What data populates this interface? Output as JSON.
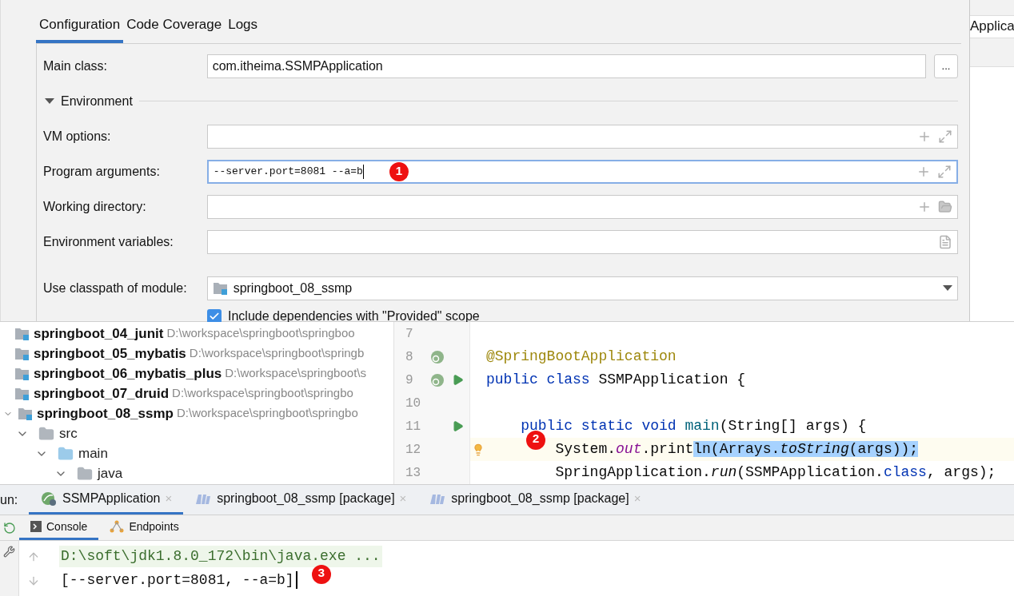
{
  "background_fragment": "Applica",
  "dialog": {
    "tabs": [
      {
        "label": "Configuration",
        "selected": true
      },
      {
        "label": "Code Coverage",
        "selected": false
      },
      {
        "label": "Logs",
        "selected": false
      }
    ],
    "main_class": {
      "label": "Main class:",
      "value": "com.itheima.SSMPApplication",
      "browse": "..."
    },
    "section": {
      "title": "Environment",
      "expanded": true
    },
    "fields": [
      {
        "label": "VM options:",
        "kind": "expandable",
        "focused": false
      },
      {
        "label": "Program arguments:",
        "kind": "expandable",
        "value": "--server.port=8081 --a=b",
        "focused": true,
        "marker": "1"
      },
      {
        "label": "Working directory:",
        "kind": "directory",
        "focused": false
      },
      {
        "label": "Environment variables:",
        "kind": "variables",
        "focused": false
      }
    ],
    "module": {
      "label": "Use classpath of module:",
      "value": "springboot_08_ssmp"
    },
    "include_dependencies": {
      "label": "Include dependencies with \"Provided\" scope",
      "checked": true
    }
  },
  "project_tree": [
    {
      "name": "springboot_04_junit",
      "path": "D:\\workspace\\springboot\\springboo",
      "expanded": false
    },
    {
      "name": "springboot_05_mybatis",
      "path": "D:\\workspace\\springboot\\springb",
      "expanded": false
    },
    {
      "name": "springboot_06_mybatis_plus",
      "path": "D:\\workspace\\springboot\\s",
      "expanded": false
    },
    {
      "name": "springboot_07_druid",
      "path": "D:\\workspace\\springboot\\springbo",
      "expanded": false
    },
    {
      "name": "springboot_08_ssmp",
      "path": "D:\\workspace\\springboot\\springbo",
      "expanded": true,
      "children": [
        {
          "name": "src",
          "expanded": true,
          "children": [
            {
              "name": "main",
              "expanded": true,
              "children": [
                {
                  "name": "java",
                  "expanded": true
                }
              ]
            }
          ]
        }
      ]
    }
  ],
  "editor": {
    "lines": [
      {
        "number": "7",
        "kind": "plain",
        "current": false
      },
      {
        "number": "8",
        "kind": "bean",
        "current": false,
        "tokens": [
          {
            "text": "@SpringBootApplication",
            "kind": "annotation",
            "selected": false
          }
        ]
      },
      {
        "number": "9",
        "kind": "bean-run",
        "current": false,
        "tokens": [
          {
            "text": "public class ",
            "kind": "keyword",
            "selected": false
          },
          {
            "text": "SSMPApplication {",
            "kind": "plain",
            "selected": false
          }
        ]
      },
      {
        "number": "10",
        "kind": "plain",
        "current": false
      },
      {
        "number": "11",
        "kind": "run",
        "current": false,
        "tokens": [
          {
            "text": "    public static void ",
            "kind": "keyword",
            "selected": false
          },
          {
            "text": "main",
            "kind": "method",
            "selected": false
          },
          {
            "text": "(String[] args) {",
            "kind": "plain",
            "selected": false
          }
        ]
      },
      {
        "number": "12",
        "kind": "intention",
        "current": true,
        "marker": "2",
        "tokens": [
          {
            "text": "        System.",
            "kind": "plain",
            "selected": false
          },
          {
            "text": "out",
            "kind": "static-field",
            "selected": false
          },
          {
            "text": ".print",
            "kind": "plain",
            "selected": false
          },
          {
            "text": "ln(Arrays.",
            "kind": "plain",
            "selected": true
          },
          {
            "text": "toString",
            "kind": "static-method",
            "selected": true
          },
          {
            "text": "(args));",
            "kind": "plain",
            "selected": true
          }
        ]
      },
      {
        "number": "13",
        "kind": "plain",
        "current": false,
        "tokens": [
          {
            "text": "        SpringApplication.",
            "kind": "plain",
            "selected": false
          },
          {
            "text": "run",
            "kind": "static-method",
            "selected": false
          },
          {
            "text": "(SSMPApplication.",
            "kind": "plain",
            "selected": false
          },
          {
            "text": "class",
            "kind": "keyword",
            "selected": false
          },
          {
            "text": ", args);",
            "kind": "plain",
            "selected": false
          }
        ]
      }
    ]
  },
  "run_panel": {
    "label": "un:",
    "tabs": [
      {
        "label": "SSMPApplication",
        "kind": "spring",
        "selected": true,
        "close": "×"
      },
      {
        "label": "springboot_08_ssmp [package]",
        "kind": "maven",
        "selected": false,
        "close": "×"
      },
      {
        "label": "springboot_08_ssmp [package]",
        "kind": "maven",
        "selected": false,
        "close": "×"
      }
    ],
    "console_tabs": [
      {
        "label": "Console",
        "kind": "console",
        "selected": true
      },
      {
        "label": "Endpoints",
        "kind": "endpoints",
        "selected": false
      }
    ],
    "output": [
      {
        "text": "D:\\soft\\jdk1.8.0_172\\bin\\java.exe ...",
        "kind": "command"
      },
      {
        "text": "[--server.port=8081, --a=b]",
        "kind": "output",
        "marker": "3"
      }
    ]
  }
}
